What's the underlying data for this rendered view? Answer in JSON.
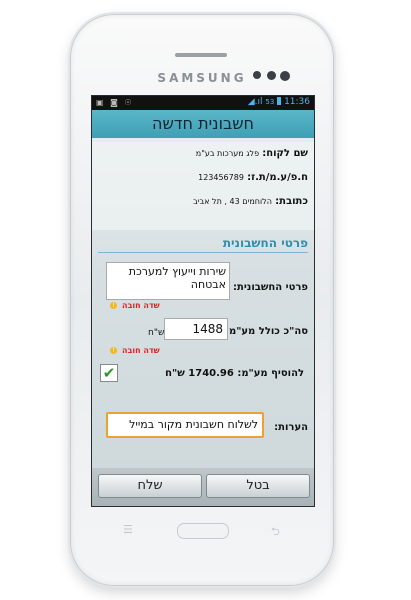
{
  "device": {
    "brand": "SAMSUNG"
  },
  "status_bar": {
    "left_icons": "▣ ◙ ☉",
    "signal": "◢.ıl",
    "battery": "53",
    "time": "11:36"
  },
  "header": {
    "title": "חשבונית חדשה"
  },
  "customer": {
    "name_label": "שם לקוח:",
    "name_value": "פלג מערכות בע\"מ",
    "id_label": "ח.פ/ע.מ/ת.ז:",
    "id_value": "123456789",
    "address_label": "כתובת:",
    "address_value": "הלוחמים 43 , תל אביב"
  },
  "invoice": {
    "section_title": "פרטי החשבונית",
    "details_label": "פרטי החשבונית:",
    "details_value": "שירות וייעוץ למערכת אבטחה",
    "required_note": "שדה חובה",
    "total_label": "סה\"כ כולל מע\"מ:",
    "total_value": "1488",
    "currency": "ש\"ח",
    "vat_label": "להוסיף מע\"מ: 1740.96 ש\"ח",
    "vat_checked": true,
    "notes_label": "הערות:",
    "notes_value": "לשלוח חשבונית מקור במייל"
  },
  "buttons": {
    "send": "שלח",
    "cancel": "בטל"
  },
  "colors": {
    "title_bar": "#4aa8bc",
    "section_title": "#2e8fb0",
    "required": "#dd2222",
    "notes_border": "#f0a030"
  }
}
